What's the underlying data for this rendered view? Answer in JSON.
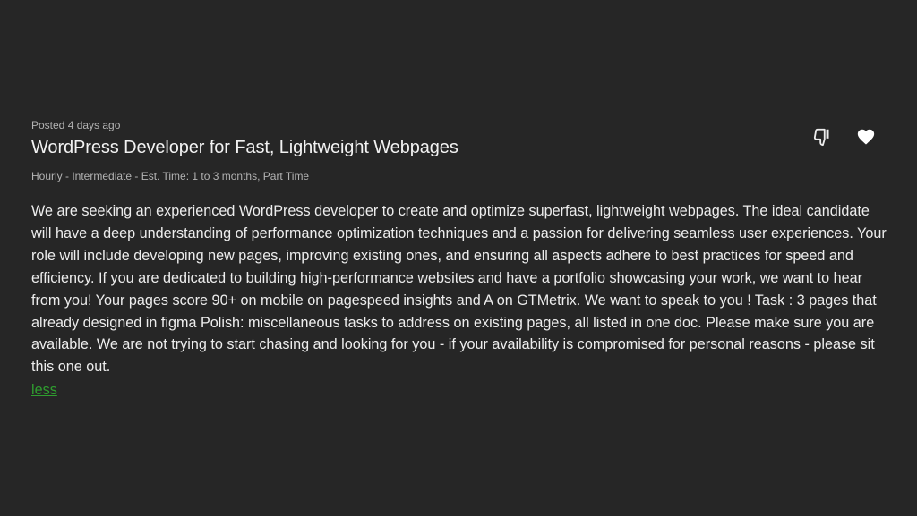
{
  "job": {
    "posted": "Posted 4 days ago",
    "title": "WordPress Developer for Fast, Lightweight Webpages",
    "meta": "Hourly - Intermediate - Est. Time: 1 to 3 months, Part Time",
    "description": "We are seeking an experienced WordPress developer to create and optimize superfast, lightweight webpages. The ideal candidate will have a deep understanding of performance optimization techniques and a passion for delivering seamless user experiences. Your role will include developing new pages, improving existing ones, and ensuring all aspects adhere to best practices for speed and efficiency. If you are dedicated to building high-performance websites and have a portfolio showcasing your work, we want to hear from you! Your pages score 90+ on mobile on pagespeed insights and A on GTMetrix. We want to speak to you ! Task : 3 pages that already designed in figma Polish: miscellaneous tasks to address on existing pages, all listed in one doc. Please make sure you are available. We are not trying to start chasing and looking for you - if your availability is compromised for personal reasons - please sit this one out.",
    "less_label": "less"
  },
  "actions": {
    "dislike_icon": "thumbs-down-icon",
    "save_icon": "heart-icon"
  },
  "colors": {
    "background": "#262626",
    "text": "#ededed",
    "muted": "#b3b3b3",
    "link": "#2f9e2f"
  }
}
